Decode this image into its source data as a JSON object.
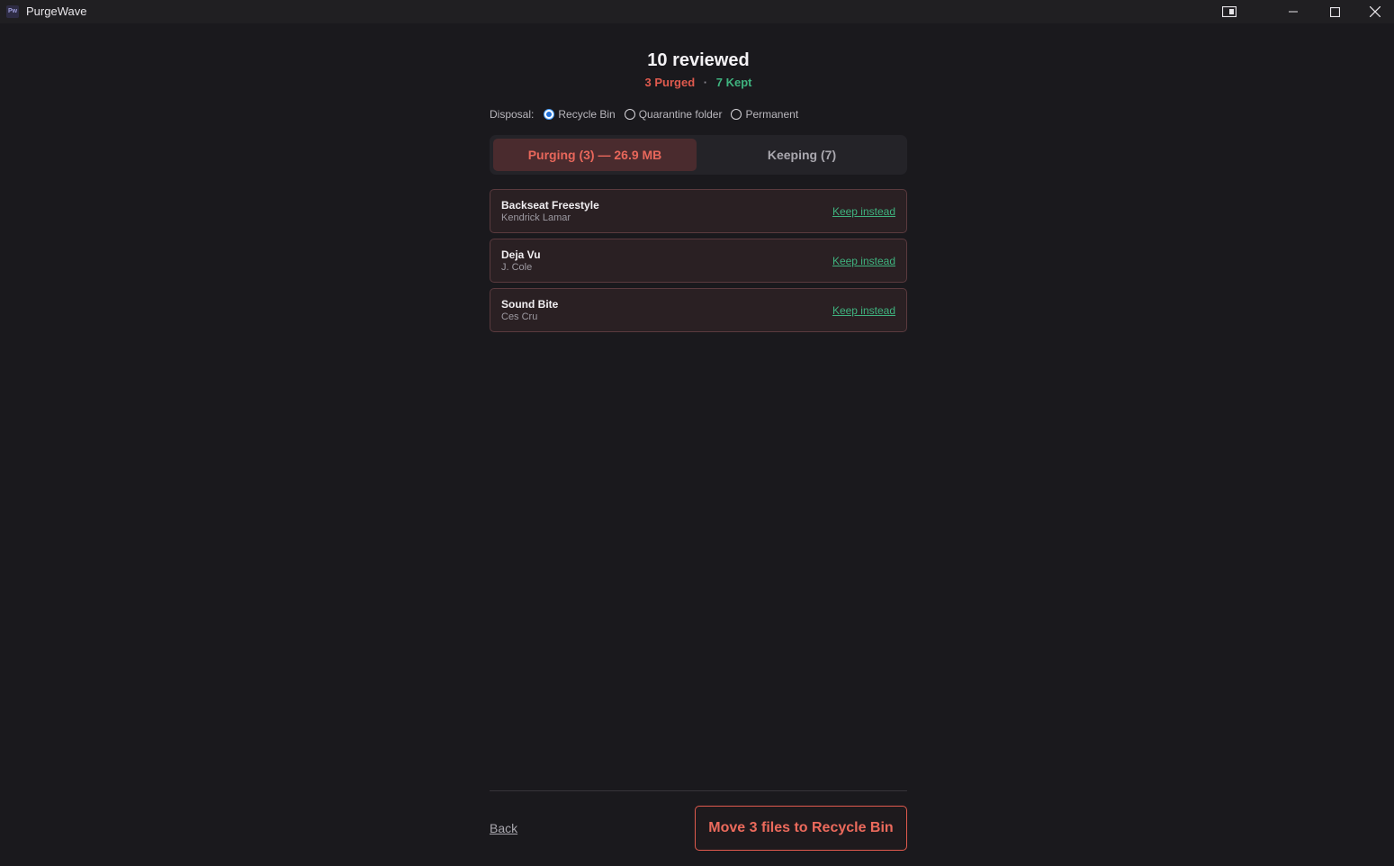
{
  "app": {
    "title": "PurgeWave",
    "logo_text": "Pw"
  },
  "window_controls": {
    "icons": [
      "snap-layout-icon",
      "minimize-icon",
      "maximize-icon",
      "close-icon"
    ]
  },
  "header": {
    "heading": "10 reviewed",
    "purged_count": "3 Purged",
    "separator": "·",
    "kept_count": "7 Kept"
  },
  "disposal": {
    "label": "Disposal:",
    "options": [
      {
        "label": "Recycle Bin",
        "selected": true
      },
      {
        "label": "Quarantine folder",
        "selected": false
      },
      {
        "label": "Permanent",
        "selected": false
      }
    ]
  },
  "tabs": [
    {
      "label": "Purging (3) — 26.9 MB",
      "active": true
    },
    {
      "label": "Keeping (7)",
      "active": false
    }
  ],
  "items": [
    {
      "title": "Backseat Freestyle",
      "artist": "Kendrick Lamar",
      "action": "Keep instead"
    },
    {
      "title": "Deja Vu",
      "artist": "J. Cole",
      "action": "Keep instead"
    },
    {
      "title": "Sound Bite",
      "artist": "Ces Cru",
      "action": "Keep instead"
    }
  ],
  "footer": {
    "back_label": "Back",
    "primary_label": "Move 3 files to Recycle Bin"
  },
  "colors": {
    "background": "#1a191d",
    "purge_accent": "#e05a4e",
    "keep_accent": "#3fb37f",
    "radio_selected": "#1e6fd9"
  }
}
